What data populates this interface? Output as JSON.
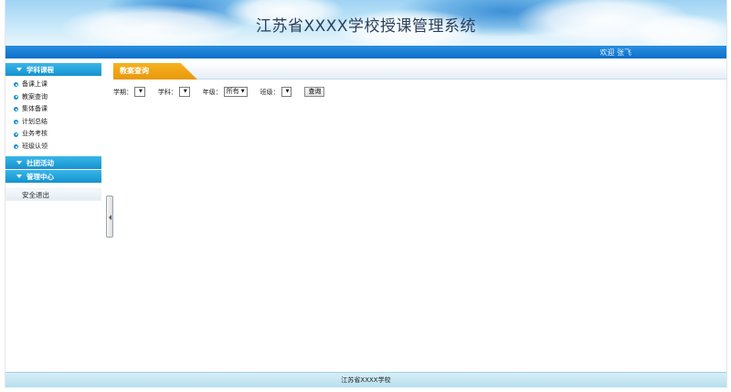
{
  "banner": {
    "title": "江苏省XXXX学校授课管理系统"
  },
  "topbar": {
    "welcome": "欢迎 张飞"
  },
  "sidebar": {
    "groups": [
      {
        "label": "学科课程",
        "items": [
          "备课上课",
          "教案查询",
          "集体备课",
          "计划总结",
          "业务考核",
          "班级认领"
        ]
      },
      {
        "label": "社团活动"
      },
      {
        "label": "管理中心"
      }
    ],
    "logout": "安全退出"
  },
  "main": {
    "tab": "教案查询",
    "filters": {
      "term_label": "学期：",
      "term_value": "",
      "subject_label": "学科：",
      "subject_value": "",
      "grade_label": "年级：",
      "grade_value": "所有",
      "class_label": "班级：",
      "class_value": "",
      "query_button": "查询"
    }
  },
  "footer": {
    "text": "江苏省XXXX学校"
  },
  "colors": {
    "accent_blue": "#1592cf",
    "tab_orange": "#f2a514",
    "bar_blue": "#0b6fc8"
  }
}
